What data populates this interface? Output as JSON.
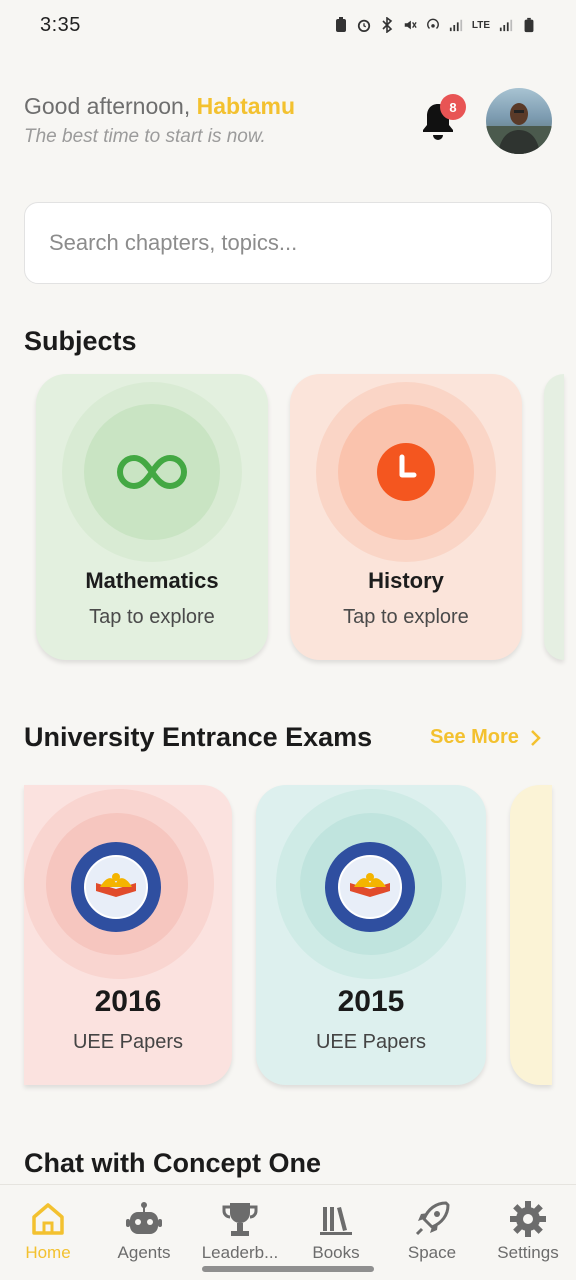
{
  "status_bar": {
    "time": "3:35",
    "network": "LTE"
  },
  "header": {
    "greeting": "Good afternoon,",
    "name": "Habtamu",
    "tagline": "The best time to start is now.",
    "notification_count": "8"
  },
  "search": {
    "placeholder": "Search chapters, topics..."
  },
  "sections": {
    "subjects_title": "Subjects",
    "exams_title": "University Entrance Exams",
    "see_more": "See More",
    "chat_title": "Chat with Concept One"
  },
  "subjects": [
    {
      "name": "Mathematics",
      "sub": "Tap to explore",
      "icon": "infinity-icon",
      "color": "#43a843"
    },
    {
      "name": "History",
      "sub": "Tap to explore",
      "icon": "clock-icon",
      "color": "#f4561f"
    }
  ],
  "exams": [
    {
      "year": "2016",
      "sub": "UEE Papers",
      "logo_text": "MINISTRY OF EDUCATION"
    },
    {
      "year": "2015",
      "sub": "UEE Papers",
      "logo_text": "MINISTRY OF EDUCATION"
    }
  ],
  "nav": [
    {
      "label": "Home",
      "icon": "home-icon",
      "active": true
    },
    {
      "label": "Agents",
      "icon": "robot-icon",
      "active": false
    },
    {
      "label": "Leaderb...",
      "icon": "trophy-icon",
      "active": false
    },
    {
      "label": "Books",
      "icon": "books-icon",
      "active": false
    },
    {
      "label": "Space",
      "icon": "rocket-icon",
      "active": false
    },
    {
      "label": "Settings",
      "icon": "gear-icon",
      "active": false
    }
  ],
  "colors": {
    "accent": "#f3c12f",
    "background": "#f7f6f3",
    "badge": "#e85454"
  }
}
